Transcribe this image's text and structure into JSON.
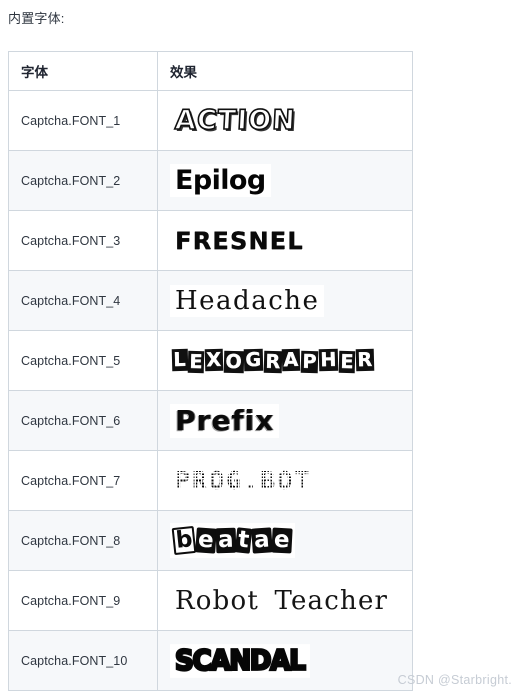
{
  "page": {
    "title": "内置字体:",
    "watermark": "CSDN @Starbright."
  },
  "table": {
    "columns": [
      "字体",
      "效果"
    ],
    "rows": [
      {
        "name": "Captcha.FONT_1",
        "sample": "ACTION"
      },
      {
        "name": "Captcha.FONT_2",
        "sample": "Epilog"
      },
      {
        "name": "Captcha.FONT_3",
        "sample": "FRESNEL"
      },
      {
        "name": "Captcha.FONT_4",
        "sample": "Headache"
      },
      {
        "name": "Captcha.FONT_5",
        "sample": "LEXOGRAPHER"
      },
      {
        "name": "Captcha.FONT_6",
        "sample": "Prefix"
      },
      {
        "name": "Captcha.FONT_7",
        "sample": "PROG.BOT"
      },
      {
        "name": "Captcha.FONT_8",
        "sample": "beatae"
      },
      {
        "name": "Captcha.FONT_9",
        "sample": "Robot Teacher"
      },
      {
        "name": "Captcha.FONT_10",
        "sample": "SCANDAL"
      }
    ]
  },
  "colors": {
    "page_background": "#ffffff",
    "table_border": "#d0d7de",
    "row_alt_background": "#f6f8fa",
    "text": "#2f3640",
    "watermark": "#c6ccd4"
  }
}
